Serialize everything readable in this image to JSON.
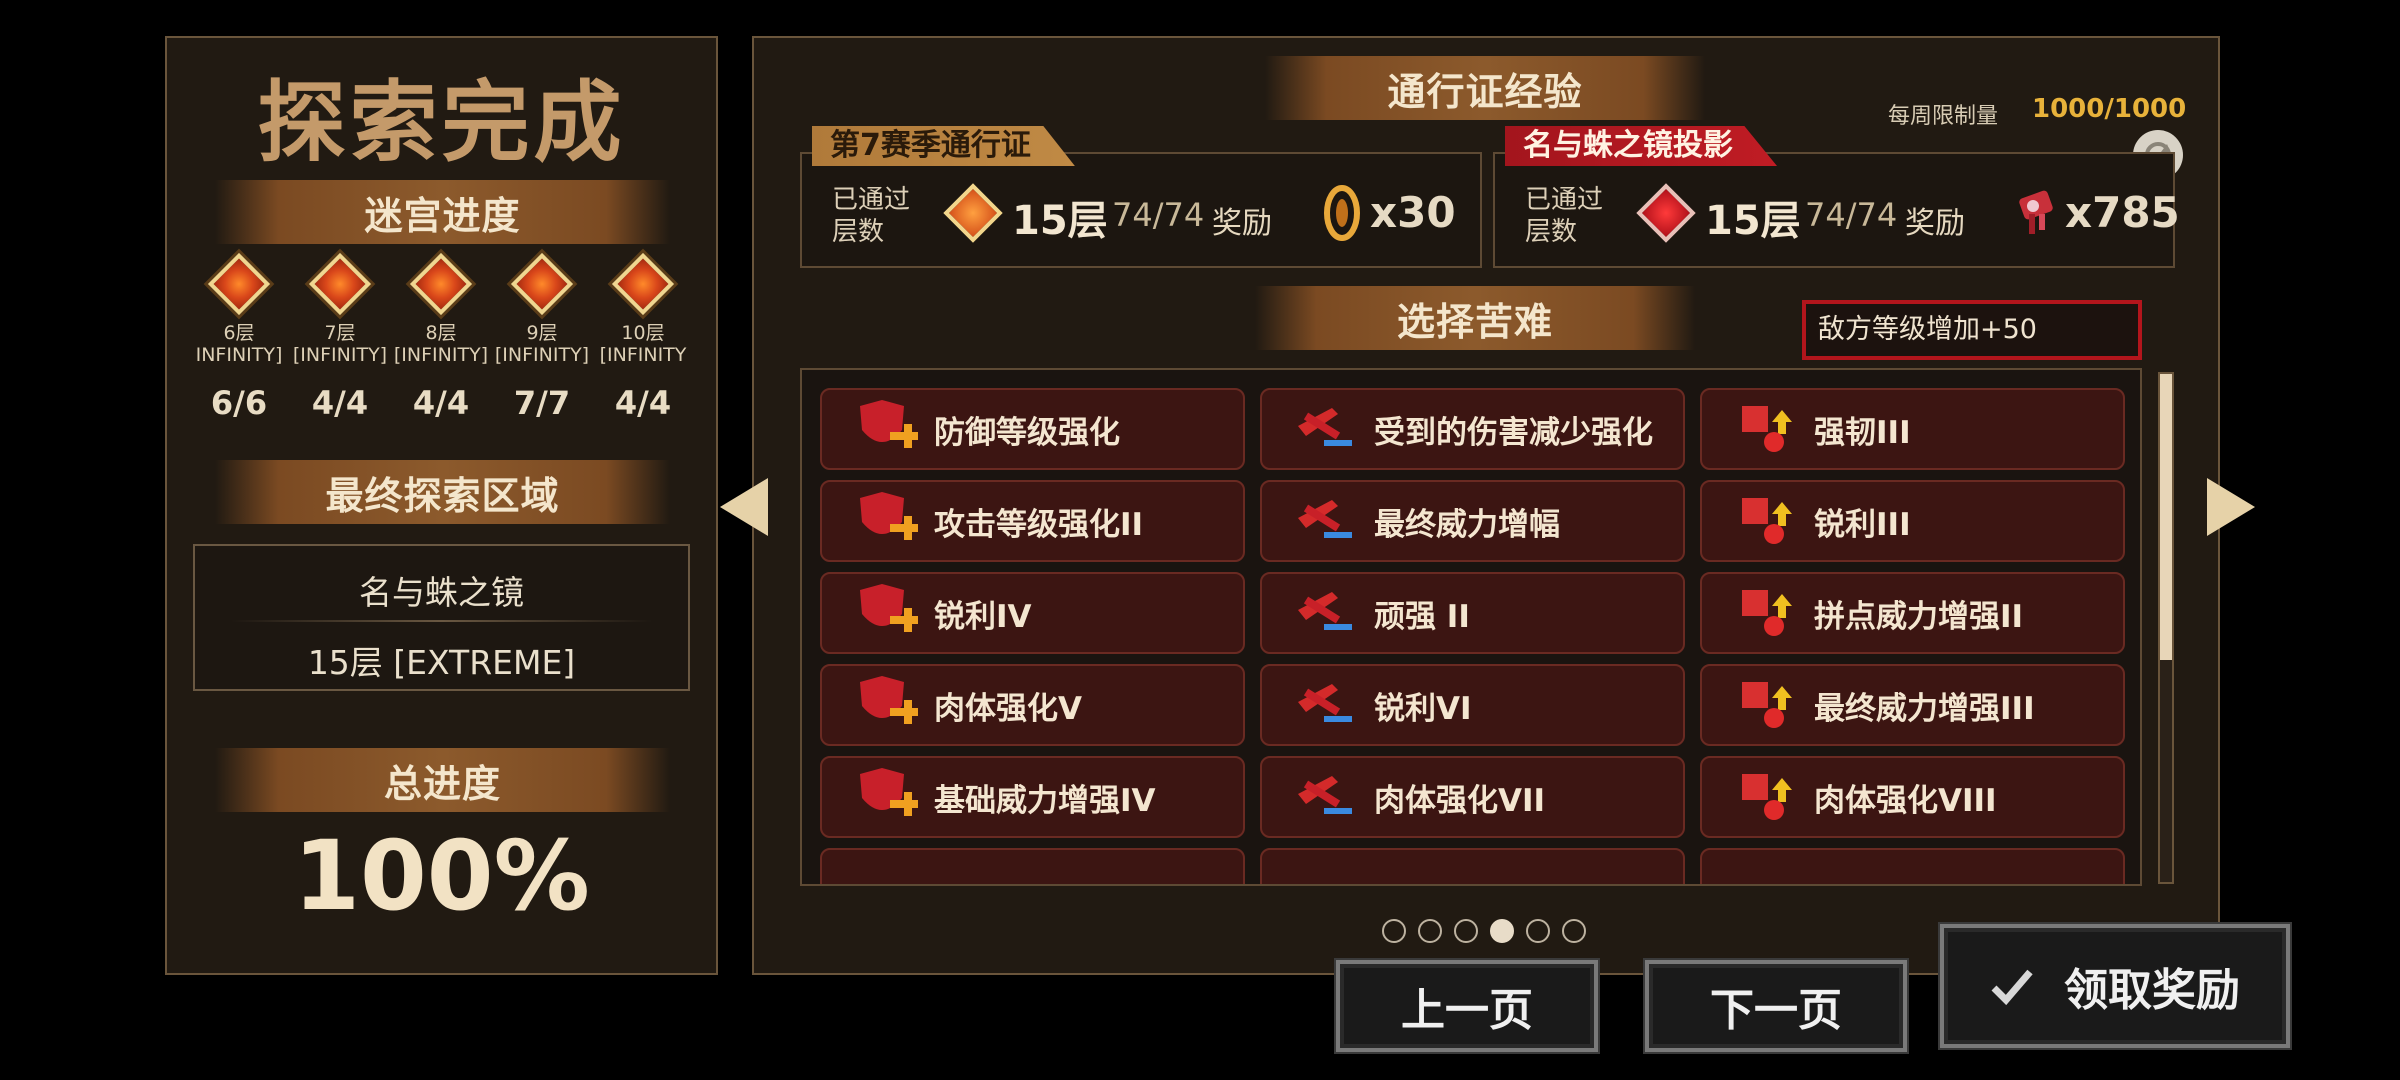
{
  "left": {
    "title": "探索完成",
    "maze_progress_label": "迷宫进度",
    "floors": [
      {
        "floor": "6层",
        "mode": "INFINITY]",
        "count": "6/6"
      },
      {
        "floor": "7层",
        "mode": "[INFINITY]",
        "count": "4/4"
      },
      {
        "floor": "8层",
        "mode": "[INFINITY]",
        "count": "4/4"
      },
      {
        "floor": "9层",
        "mode": "[INFINITY]",
        "count": "7/7"
      },
      {
        "floor": "10层",
        "mode": "[INFINITY",
        "count": "4/4"
      }
    ],
    "final_area_label": "最终探索区域",
    "final_area_name": "名与蛛之镜",
    "final_area_floor": "15层 [EXTREME]",
    "total_progress_label": "总进度",
    "total_progress_value": "100%"
  },
  "main": {
    "pass_exp_label": "通行证经验",
    "weekly_limit_label": "每周限制量",
    "weekly_limit_value": "1000/1000",
    "passes": [
      {
        "tag": "第7赛季通行证",
        "passed_label": "已通过层数",
        "floor": "15层",
        "ratio": "74/74",
        "reward_label": "奖励",
        "reward_count": "x30"
      },
      {
        "tag": "名与蛛之镜投影",
        "passed_label": "已通过层数",
        "floor": "15层",
        "ratio": "74/74",
        "reward_label": "奖励",
        "reward_count": "x785"
      }
    ],
    "select_hardship_label": "选择苦难",
    "enemy_level_text": "敌方等级增加+50",
    "hardships": [
      "防御等级强化",
      "受到的伤害减少强化",
      "强韧III",
      "攻击等级强化II",
      "最终威力增幅",
      "锐利III",
      "锐利IV",
      "顽强 II",
      "拼点威力增强II",
      "肉体强化V",
      "锐利VI",
      "最终威力增强III",
      "基础威力增强IV",
      "肉体强化VII",
      "肉体强化VIII"
    ],
    "page_dots": 6,
    "active_page": 4
  },
  "buttons": {
    "prev": "上一页",
    "next": "下一页",
    "claim": "领取奖励"
  },
  "colors": {
    "accent_gold": "#e8b23a",
    "accent_red": "#b3151c",
    "item_bg": "#3c1512"
  },
  "icons": {
    "pass_reward_1": "gold-ring-icon",
    "pass_reward_2": "ribbon-ticket-icon",
    "refresh": "refresh-icon",
    "claim": "check-icon"
  }
}
